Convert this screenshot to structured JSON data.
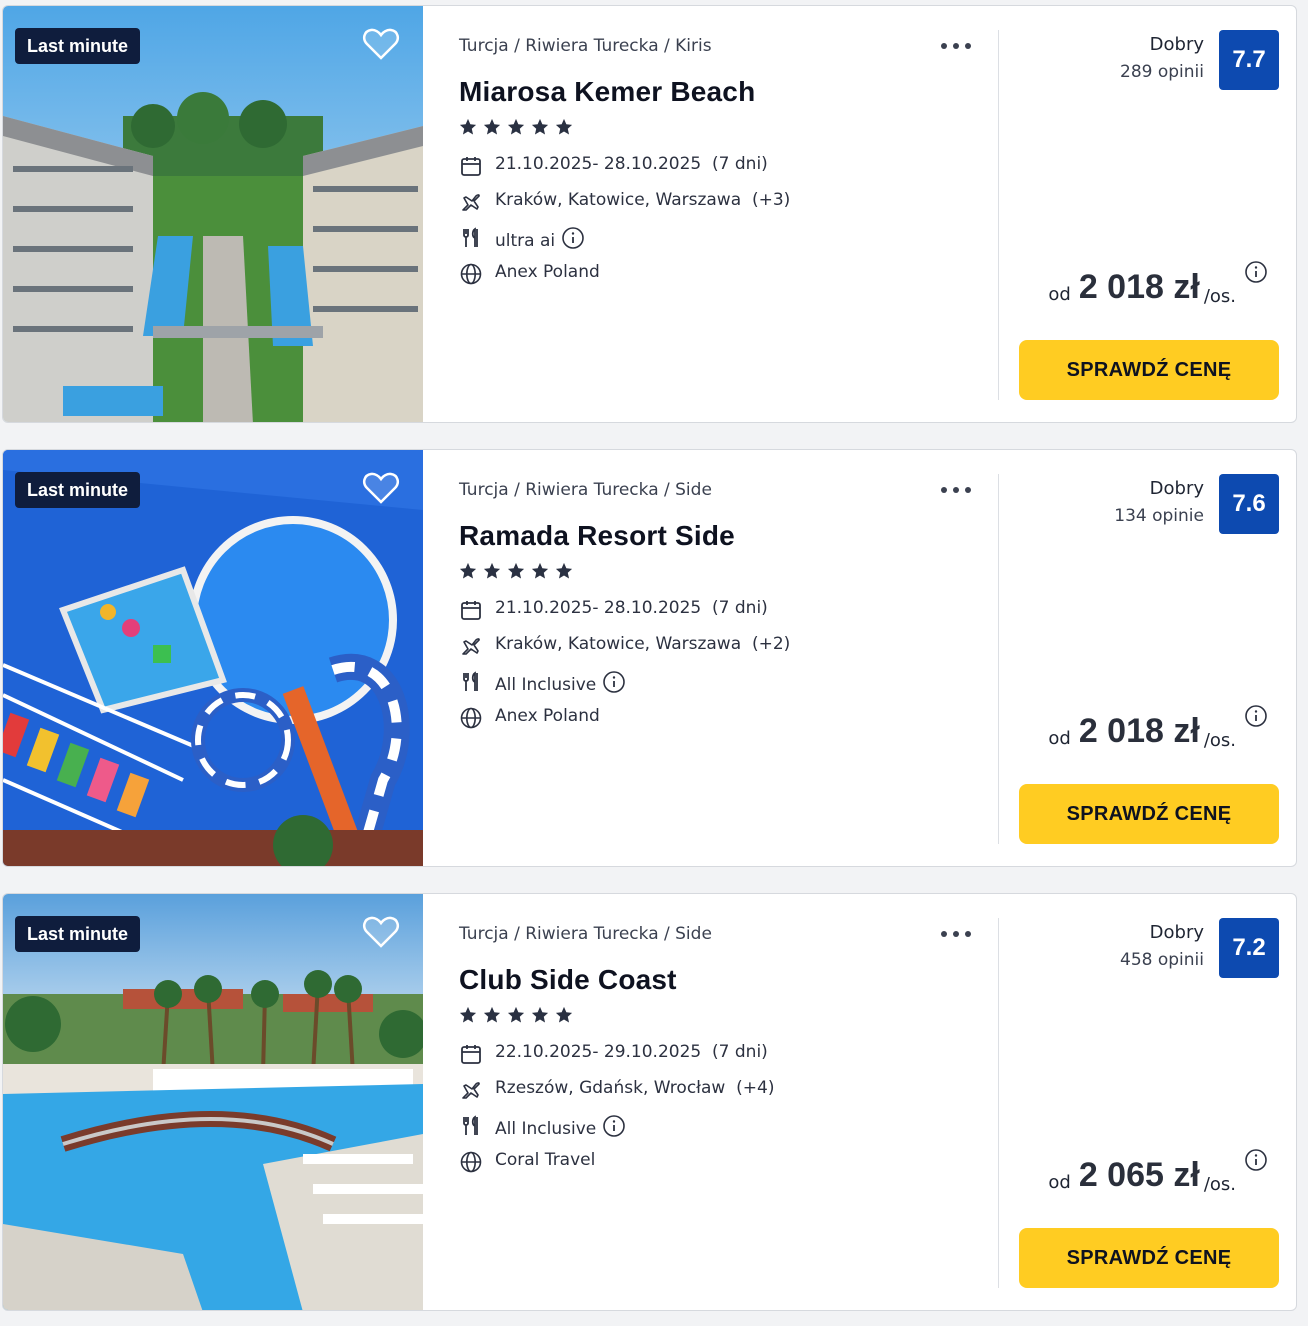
{
  "offers": [
    {
      "badge": "Last minute",
      "location": "Turcja / Riwiera Turecka / Kiris",
      "name": "Miarosa Kemer Beach",
      "stars": 5,
      "dates": "21.10.2025- 28.10.2025",
      "duration": "(7 dni)",
      "airports": "Kraków, Katowice, Warszawa",
      "airports_more": "(+3)",
      "board": "ultra ai",
      "operator": "Anex Poland",
      "rating_label": "Dobry",
      "rating_count": "289 opinii",
      "rating_score": "7.7",
      "price_prefix": "od",
      "price": "2 018 zł",
      "price_suffix": "/os.",
      "cta": "SPRAWDŹ CENĘ",
      "image": "hotel-courtyard-pools"
    },
    {
      "badge": "Last minute",
      "location": "Turcja / Riwiera Turecka / Side",
      "name": "Ramada Resort Side",
      "stars": 5,
      "dates": "21.10.2025- 28.10.2025",
      "duration": "(7 dni)",
      "airports": "Kraków, Katowice, Warszawa",
      "airports_more": "(+2)",
      "board": "All Inclusive",
      "operator": "Anex Poland",
      "rating_label": "Dobry",
      "rating_count": "134 opinie",
      "rating_score": "7.6",
      "price_prefix": "od",
      "price": "2 018 zł",
      "price_suffix": "/os.",
      "cta": "SPRAWDŹ CENĘ",
      "image": "aerial-waterslides"
    },
    {
      "badge": "Last minute",
      "location": "Turcja / Riwiera Turecka / Side",
      "name": "Club Side Coast",
      "stars": 5,
      "dates": "22.10.2025- 29.10.2025",
      "duration": "(7 dni)",
      "airports": "Rzeszów, Gdańsk, Wrocław",
      "airports_more": "(+4)",
      "board": "All Inclusive",
      "operator": "Coral Travel",
      "rating_label": "Dobry",
      "rating_count": "458 opinii",
      "rating_score": "7.2",
      "price_prefix": "od",
      "price": "2 065 zł",
      "price_suffix": "/os.",
      "cta": "SPRAWDŹ CENĘ",
      "image": "pool-with-bridge-palms"
    }
  ],
  "colors": {
    "badge_bg": "#0f1d3d",
    "score_bg": "#0d4ab0",
    "cta_bg": "#ffcc22",
    "star": "#2a3142"
  },
  "icons": [
    "heart-icon",
    "more-dots-icon",
    "star-icon",
    "calendar-icon",
    "plane-icon",
    "cutlery-icon",
    "info-icon",
    "globe-icon"
  ]
}
